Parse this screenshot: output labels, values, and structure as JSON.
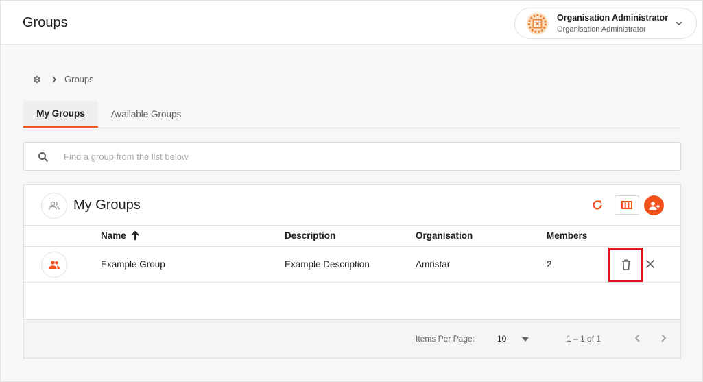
{
  "header": {
    "title": "Groups",
    "user": {
      "name": "Organisation Administrator",
      "role": "Organisation Administrator"
    }
  },
  "breadcrumb": {
    "current": "Groups"
  },
  "tabs": [
    {
      "label": "My Groups",
      "active": true
    },
    {
      "label": "Available Groups",
      "active": false
    }
  ],
  "search": {
    "placeholder": "Find a group from the list below",
    "value": ""
  },
  "panel": {
    "title": "My Groups"
  },
  "table": {
    "columns": [
      "Name",
      "Description",
      "Organisation",
      "Members"
    ],
    "sort_column": "Name",
    "sort_direction": "ascending",
    "rows": [
      {
        "name": "Example Group",
        "description": "Example Description",
        "organisation": "Amristar",
        "members": "2"
      }
    ]
  },
  "pagination": {
    "items_per_page_label": "Items Per Page:",
    "items_per_page": "10",
    "range": "1 – 1 of 1"
  },
  "colors": {
    "accent": "#f2511b",
    "highlight_border": "#e0161e"
  }
}
